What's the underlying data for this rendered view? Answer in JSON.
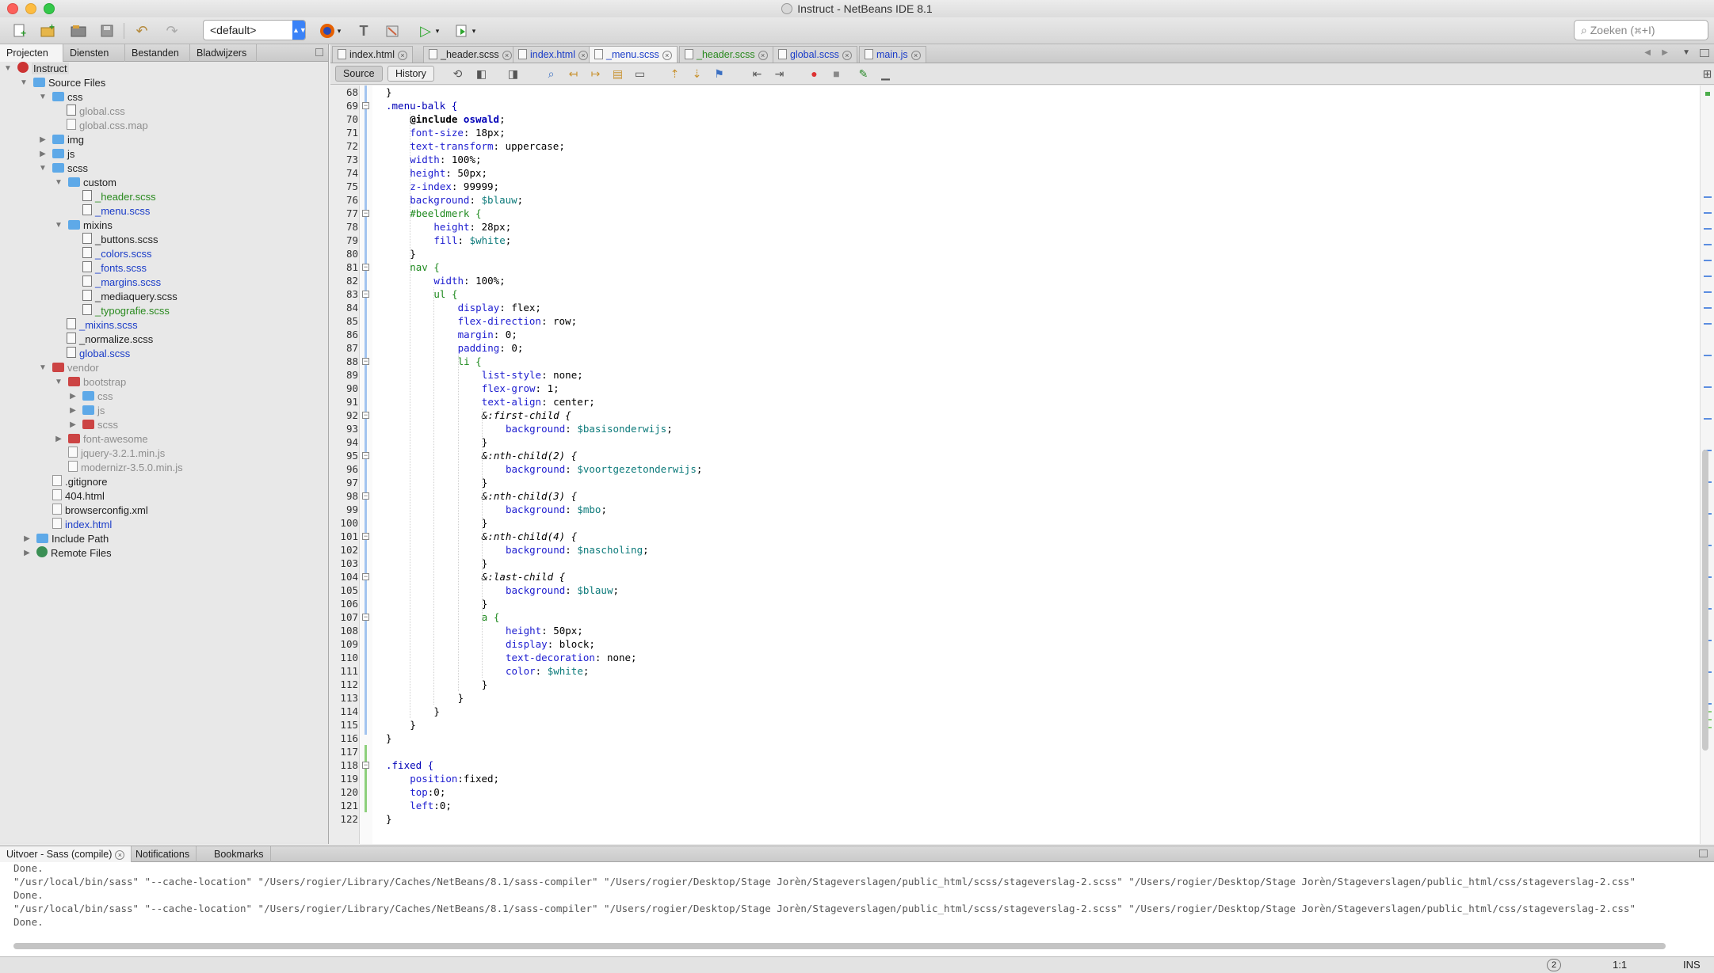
{
  "window": {
    "title": "Instruct - NetBeans IDE 8.1"
  },
  "toolbar": {
    "config": "<default>",
    "search_placeholder": "Zoeken (⌘+I)"
  },
  "left_tabs": [
    "Projecten",
    "Diensten",
    "Bestanden",
    "Bladwijzers"
  ],
  "tree": [
    {
      "label": "Instruct",
      "icon": "project-icon",
      "color": "normal"
    },
    {
      "label": "Source Files",
      "icon": "folder-icon",
      "color": "normal"
    },
    {
      "label": "css",
      "icon": "folder-icon",
      "color": "normal"
    },
    {
      "label": "global.css",
      "icon": "css-file-icon",
      "color": "gray"
    },
    {
      "label": "global.css.map",
      "icon": "file-icon",
      "color": "gray"
    },
    {
      "label": "img",
      "icon": "folder-icon",
      "color": "normal"
    },
    {
      "label": "js",
      "icon": "folder-icon",
      "color": "normal"
    },
    {
      "label": "scss",
      "icon": "folder-icon",
      "color": "normal"
    },
    {
      "label": "custom",
      "icon": "folder-icon",
      "color": "normal"
    },
    {
      "label": "_header.scss",
      "icon": "scss-file-icon",
      "color": "green"
    },
    {
      "label": "_menu.scss",
      "icon": "scss-file-icon",
      "color": "blue"
    },
    {
      "label": "mixins",
      "icon": "folder-icon",
      "color": "normal"
    },
    {
      "label": "_buttons.scss",
      "icon": "scss-file-icon",
      "color": "normal"
    },
    {
      "label": "_colors.scss",
      "icon": "scss-file-icon",
      "color": "blue"
    },
    {
      "label": "_fonts.scss",
      "icon": "scss-file-icon",
      "color": "blue"
    },
    {
      "label": "_margins.scss",
      "icon": "scss-file-icon",
      "color": "blue"
    },
    {
      "label": "_mediaquery.scss",
      "icon": "scss-file-icon",
      "color": "normal"
    },
    {
      "label": "_typografie.scss",
      "icon": "scss-file-icon",
      "color": "green"
    },
    {
      "label": "_mixins.scss",
      "icon": "scss-file-icon",
      "color": "blue"
    },
    {
      "label": "_normalize.scss",
      "icon": "scss-file-icon",
      "color": "normal"
    },
    {
      "label": "global.scss",
      "icon": "scss-file-icon",
      "color": "blue"
    },
    {
      "label": "vendor",
      "icon": "folder-icon",
      "color": "gray"
    },
    {
      "label": "bootstrap",
      "icon": "folder-icon",
      "color": "gray"
    },
    {
      "label": "css",
      "icon": "folder-icon",
      "color": "gray"
    },
    {
      "label": "js",
      "icon": "folder-icon",
      "color": "gray"
    },
    {
      "label": "scss",
      "icon": "folder-icon",
      "color": "gray"
    },
    {
      "label": "font-awesome",
      "icon": "folder-icon",
      "color": "gray"
    },
    {
      "label": "jquery-3.2.1.min.js",
      "icon": "js-file-icon",
      "color": "gray"
    },
    {
      "label": "modernizr-3.5.0.min.js",
      "icon": "js-file-icon",
      "color": "gray"
    },
    {
      "label": ".gitignore",
      "icon": "file-icon",
      "color": "normal"
    },
    {
      "label": "404.html",
      "icon": "html-file-icon",
      "color": "normal"
    },
    {
      "label": "browserconfig.xml",
      "icon": "xml-file-icon",
      "color": "normal"
    },
    {
      "label": "index.html",
      "icon": "html-file-icon",
      "color": "blue"
    },
    {
      "label": "Include Path",
      "icon": "folder-icon",
      "color": "normal"
    },
    {
      "label": "Remote Files",
      "icon": "globe-icon",
      "color": "normal"
    }
  ],
  "editor_tabs": [
    {
      "label": "index.html",
      "color": "normal"
    },
    {
      "label": "_header.scss",
      "color": "normal"
    },
    {
      "label": "index.html",
      "color": "blue"
    },
    {
      "label": "_menu.scss",
      "color": "blue"
    },
    {
      "label": "_header.scss",
      "color": "green"
    },
    {
      "label": "global.scss",
      "color": "blue"
    },
    {
      "label": "main.js",
      "color": "blue"
    }
  ],
  "editor_toolbar": {
    "source": "Source",
    "history": "History"
  },
  "code": {
    "line_numbers": [
      "68",
      "69",
      "70",
      "71",
      "72",
      "73",
      "74",
      "75",
      "76",
      "77",
      "78",
      "79",
      "80",
      "81",
      "82",
      "83",
      "84",
      "85",
      "86",
      "87",
      "88",
      "89",
      "90",
      "91",
      "92",
      "93",
      "94",
      "95",
      "96",
      "97",
      "98",
      "99",
      "100",
      "101",
      "102",
      "103",
      "104",
      "105",
      "106",
      "107",
      "108",
      "109",
      "110",
      "111",
      "112",
      "113",
      "114",
      "115",
      "116",
      "117",
      "118",
      "119",
      "120",
      "121",
      "122"
    ],
    "line1": "}",
    "line2": ".menu-balk {",
    "line3": "@include oswald;",
    "line4": "font-size: 18px;",
    "line5": "text-transform: uppercase;",
    "line6": "width: 100%;",
    "line7": "height: 50px;",
    "line8": "z-index: 99999;",
    "line9": "background: $blauw;",
    "line10": "#beeldmerk {",
    "line11": "height: 28px;",
    "line12": "fill: $white;",
    "line13": "}",
    "line14": "nav {",
    "line15": "width: 100%;",
    "line16": "ul {",
    "line17": "display: flex;",
    "line18": "flex-direction: row;",
    "line19": "margin: 0;",
    "line20": "padding: 0;",
    "line21": "li {",
    "line22": "list-style: none;",
    "line23": "flex-grow: 1;",
    "line24": "text-align: center;",
    "line25": "&:first-child {",
    "line26": "background: $basisonderwijs;",
    "line27": "}",
    "line28": "&:nth-child(2) {",
    "line29": "background: $voortgezetonderwijs;",
    "line30": "}",
    "line31": "&:nth-child(3) {",
    "line32": "background: $mbo;",
    "line33": "}",
    "line34": "&:nth-child(4) {",
    "line35": "background: $nascholing;",
    "line36": "}",
    "line37": "&:last-child {",
    "line38": "background: $blauw;",
    "line39": "}",
    "line40": "a {",
    "line41": "height: 50px;",
    "line42": "display: block;",
    "line43": "text-decoration: none;",
    "line44": "color: $white;",
    "line45": "}",
    "line46": "}",
    "line47": "}",
    "line48": "}",
    "line49": "}",
    "line50": "",
    "line51": ".fixed {",
    "line52": "position:fixed;",
    "line53": "top:0;",
    "line54": "left:0;",
    "line55": "}"
  },
  "output_tabs": [
    "Uitvoer - Sass (compile)",
    "Notifications",
    "Bookmarks"
  ],
  "output_lines": [
    "Done.",
    "\"/usr/local/bin/sass\" \"--cache-location\" \"/Users/rogier/Library/Caches/NetBeans/8.1/sass-compiler\" \"/Users/rogier/Desktop/Stage Jorèn/Stageverslagen/public_html/scss/stageverslag-2.scss\" \"/Users/rogier/Desktop/Stage Jorèn/Stageverslagen/public_html/css/stageverslag-2.css\"",
    "Done.",
    "\"/usr/local/bin/sass\" \"--cache-location\" \"/Users/rogier/Library/Caches/NetBeans/8.1/sass-compiler\" \"/Users/rogier/Desktop/Stage Jorèn/Stageverslagen/public_html/scss/stageverslag-2.scss\" \"/Users/rogier/Desktop/Stage Jorèn/Stageverslagen/public_html/css/stageverslag-2.css\"",
    "Done."
  ],
  "status": {
    "notifications": "2",
    "position": "1:1",
    "mode": "INS"
  }
}
